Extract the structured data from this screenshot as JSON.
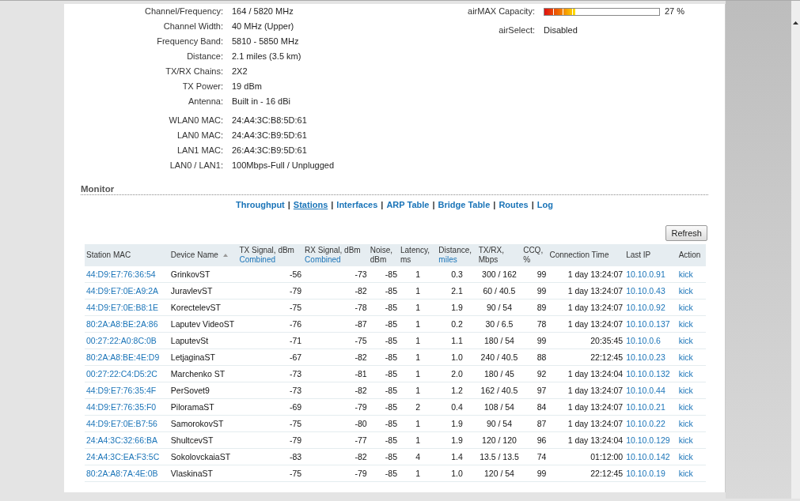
{
  "info_left": [
    {
      "label": "Channel/Frequency:",
      "value": "164 / 5820 MHz"
    },
    {
      "label": "Channel Width:",
      "value": "40 MHz (Upper)"
    },
    {
      "label": "Frequency Band:",
      "value": "5810 - 5850 MHz"
    },
    {
      "label": "Distance:",
      "value": "2.1 miles (3.5 km)"
    },
    {
      "label": "TX/RX Chains:",
      "value": "2X2"
    },
    {
      "label": "TX Power:",
      "value": "19 dBm"
    },
    {
      "label": "Antenna:",
      "value": "Built in - 16 dBi"
    },
    {
      "label": "WLAN0 MAC:",
      "value": "24:A4:3C:B8:5D:61",
      "group_start": true
    },
    {
      "label": "LAN0 MAC:",
      "value": "24:A4:3C:B9:5D:61"
    },
    {
      "label": "LAN1 MAC:",
      "value": "26:A4:3C:B9:5D:61"
    },
    {
      "label": "LAN0 / LAN1:",
      "value": "100Mbps-Full / Unplugged"
    }
  ],
  "info_right": [
    {
      "kind": "meter",
      "label": "airMAX Capacity:",
      "level": 0.27,
      "reading": "27 %"
    },
    {
      "kind": "text",
      "label": "airSelect:",
      "value": "Disabled"
    }
  ],
  "monitor": {
    "title": "Monitor",
    "separator": "|",
    "links": [
      {
        "label": "Throughput",
        "selected": false
      },
      {
        "label": "Stations",
        "selected": true
      },
      {
        "label": "Interfaces",
        "selected": false
      },
      {
        "label": "ARP Table",
        "selected": false
      },
      {
        "label": "Bridge Table",
        "selected": false
      },
      {
        "label": "Routes",
        "selected": false
      },
      {
        "label": "Log",
        "selected": false
      }
    ],
    "refresh_button": "Refresh"
  },
  "table": {
    "columns": [
      {
        "label": "Station MAC"
      },
      {
        "label": "Device Name",
        "sorted": true
      },
      {
        "label": "TX Signal, dBm",
        "sub": "Combined"
      },
      {
        "label": "RX Signal, dBm",
        "sub": "Combined"
      },
      {
        "label": "Noise, dBm"
      },
      {
        "label": "Latency, ms"
      },
      {
        "label": "Distance,",
        "sub": "miles"
      },
      {
        "label": "TX/RX, Mbps"
      },
      {
        "label": "CCQ, %"
      },
      {
        "label": "Connection Time"
      },
      {
        "label": "Last IP"
      },
      {
        "label": "Action"
      }
    ],
    "rows": [
      [
        "44:D9:E7:76:36:54",
        "GrinkovST",
        "-56",
        "-73",
        "-85",
        "1",
        "0.3",
        "300 / 162",
        "99",
        "1 day 13:24:07",
        "10.10.0.91",
        "kick"
      ],
      [
        "44:D9:E7:0E:A9:2A",
        "JuravlevST",
        "-79",
        "-82",
        "-85",
        "1",
        "2.1",
        "60 / 40.5",
        "99",
        "1 day 13:24:07",
        "10.10.0.43",
        "kick"
      ],
      [
        "44:D9:E7:0E:B8:1E",
        "KorectelevST",
        "-75",
        "-78",
        "-85",
        "1",
        "1.9",
        "90 / 54",
        "89",
        "1 day 13:24:07",
        "10.10.0.92",
        "kick"
      ],
      [
        "80:2A:A8:BE:2A:86",
        "Laputev VideoST",
        "-76",
        "-87",
        "-85",
        "1",
        "0.2",
        "30 / 6.5",
        "78",
        "1 day 13:24:07",
        "10.10.0.137",
        "kick"
      ],
      [
        "00:27:22:A0:8C:0B",
        "LaputevSt",
        "-71",
        "-75",
        "-85",
        "1",
        "1.1",
        "180 / 54",
        "99",
        "20:35:45",
        "10.10.0.6",
        "kick"
      ],
      [
        "80:2A:A8:BE:4E:D9",
        "LetjaginaST",
        "-67",
        "-82",
        "-85",
        "1",
        "1.0",
        "240 / 40.5",
        "88",
        "22:12:45",
        "10.10.0.23",
        "kick"
      ],
      [
        "00:27:22:C4:D5:2C",
        "Marchenko ST",
        "-73",
        "-81",
        "-85",
        "1",
        "2.0",
        "180 / 45",
        "92",
        "1 day 13:24:04",
        "10.10.0.132",
        "kick"
      ],
      [
        "44:D9:E7:76:35:4F",
        "PerSovet9",
        "-73",
        "-82",
        "-85",
        "1",
        "1.2",
        "162 / 40.5",
        "97",
        "1 day 13:24:07",
        "10.10.0.44",
        "kick"
      ],
      [
        "44:D9:E7:76:35:F0",
        "PiloramaST",
        "-69",
        "-79",
        "-85",
        "2",
        "0.4",
        "108 / 54",
        "84",
        "1 day 13:24:07",
        "10.10.0.21",
        "kick"
      ],
      [
        "44:D9:E7:0E:B7:56",
        "SamorokovST",
        "-75",
        "-80",
        "-85",
        "1",
        "1.9",
        "90 / 54",
        "87",
        "1 day 13:24:07",
        "10.10.0.22",
        "kick"
      ],
      [
        "24:A4:3C:32:66:BA",
        "ShultcevST",
        "-79",
        "-77",
        "-85",
        "1",
        "1.9",
        "120 / 120",
        "96",
        "1 day 13:24:04",
        "10.10.0.129",
        "kick"
      ],
      [
        "24:A4:3C:EA:F3:5C",
        "SokolovckaiaST",
        "-83",
        "-82",
        "-85",
        "4",
        "1.4",
        "13.5 / 13.5",
        "74",
        "01:12:00",
        "10.10.0.142",
        "kick"
      ],
      [
        "80:2A:A8:7A:4E:0B",
        "VlaskinaST",
        "-75",
        "-79",
        "-85",
        "1",
        "1.0",
        "120 / 54",
        "99",
        "22:12:45",
        "10.10.0.19",
        "kick"
      ]
    ]
  }
}
